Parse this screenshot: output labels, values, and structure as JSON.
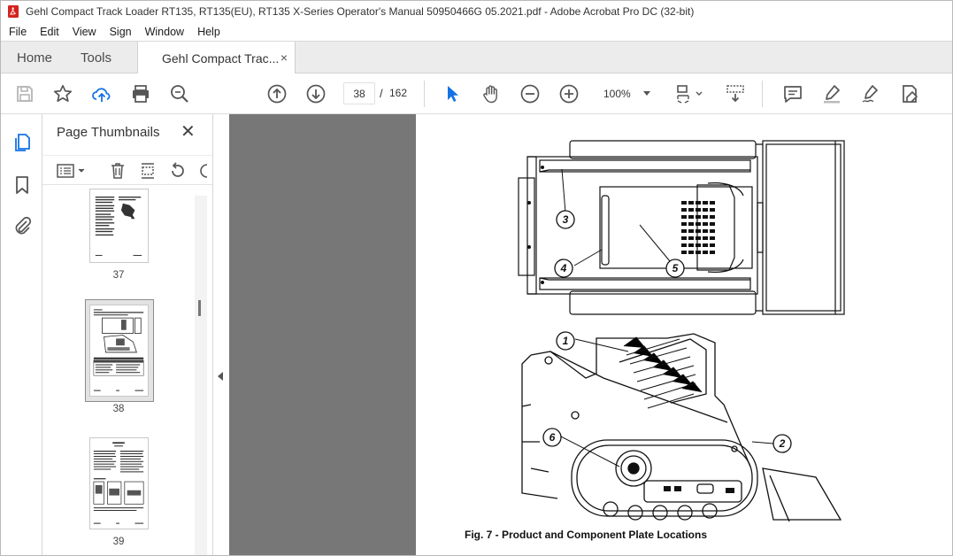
{
  "window": {
    "title": "Gehl Compact Track Loader RT135, RT135(EU), RT135 X-Series Operator's Manual 50950466G 05.2021.pdf - Adobe Acrobat Pro DC (32-bit)"
  },
  "menu": [
    "File",
    "Edit",
    "View",
    "Sign",
    "Window",
    "Help"
  ],
  "tabs": {
    "home": "Home",
    "tools": "Tools",
    "document": "Gehl Compact Trac...",
    "close": "×"
  },
  "toolbar": {
    "current_page": "38",
    "separator": "/",
    "total_pages": "162",
    "zoom": "100%"
  },
  "thumbnails": {
    "title": "Page Thumbnails",
    "close": "✕",
    "pages": [
      {
        "label": "37",
        "selected": false
      },
      {
        "label": "38",
        "selected": true
      },
      {
        "label": "39",
        "selected": false
      }
    ]
  },
  "document": {
    "figure_caption": "Fig. 7 -  Product and Component Plate Locations",
    "callouts": [
      "1",
      "2",
      "3",
      "4",
      "5",
      "6"
    ]
  },
  "colors": {
    "acrobat_red": "#d4231f",
    "upload_blue": "#1473e6",
    "select_arrow": "#1473e6",
    "viewer_gray": "#777777",
    "tab_bar": "#ececec"
  },
  "icons": {
    "save": "save-icon",
    "bookmark": "star-icon",
    "upload": "upload-cloud-icon",
    "print": "printer-icon",
    "find": "search-zoom-icon",
    "prev": "arrow-up-circle-icon",
    "next": "arrow-down-circle-icon",
    "select": "pointer-arrow-icon",
    "hand": "hand-icon",
    "zoom_out": "minus-circle-icon",
    "zoom_in": "plus-circle-icon"
  }
}
